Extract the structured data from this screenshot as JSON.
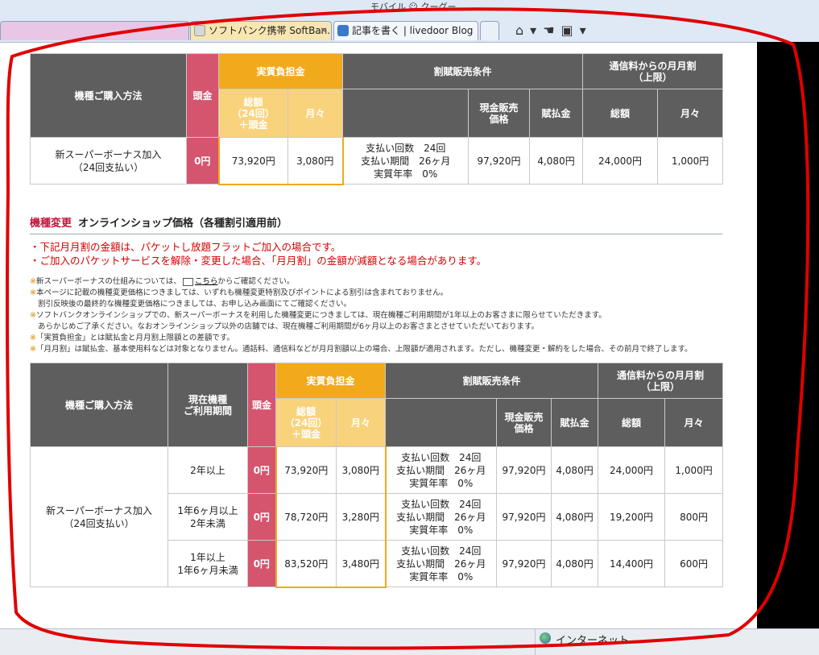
{
  "browser": {
    "top_strip_text": "モバイル ☺ クーグー",
    "tabs": [
      {
        "label": "ソフトバンク携帯 SoftBan...",
        "active": true
      },
      {
        "label": "記事を書く | livedoor Blog",
        "active": false
      }
    ],
    "close_glyph": "✕",
    "toolbar_icons": [
      "home-icon",
      "hand-icon",
      "rss-icon"
    ]
  },
  "table1": {
    "head": {
      "method": "機種ご購入方法",
      "down": "頭金",
      "burden": "実質負担金",
      "total": "総額\n（24回）\n＋頭金",
      "monthly": "月々",
      "installment": "割賦販売条件",
      "cash_price": "現金販売\n価格",
      "paid": "賦払金",
      "discount": "通信料からの月月割\n（上限）",
      "disc_total": "総額",
      "disc_monthly": "月々"
    },
    "row": {
      "method": "新スーパーボーナス加入\n（24回支払い）",
      "down": "0円",
      "total": "73,920円",
      "monthly": "3,080円",
      "terms": "支払い回数　24回\n支払い期間　26ヶ月\n実質年率　0%",
      "cash": "97,920円",
      "paid": "4,080円",
      "disc_total": "24,000円",
      "disc_monthly": "1,000円"
    }
  },
  "section": {
    "tag": "機種変更",
    "title": "オンラインショップ価格（各種割引適用前）",
    "red_notes": [
      "・下記月月割の金額は、パケットし放題フラットご加入の場合です。",
      "・ご加入のパケットサービスを解除・変更した場合、「月月割」の金額が減額となる場合があります。"
    ],
    "notes": {
      "mark": "※",
      "n1_pre": "新スーパーボーナスの仕組みについては、",
      "n1_link": "こちら",
      "n1_post": "からご確認ください。",
      "n2": "本ページに記載の機種変更価格につきましては、いずれも機種変更特割及びポイントによる割引は含まれておりません。",
      "n2b": "割引反映後の最終的な機種変更価格につきましては、お申し込み画面にてご確認ください。",
      "n3": "ソフトバンクオンラインショップでの、新スーパーボーナスを利用した機種変更につきましては、現在機種ご利用期間が1年以上のお客さまに限らせていただきます。",
      "n3b": "あらかじめご了承ください。なおオンラインショップ以外の店舗では、現在機種ご利用期間が6ヶ月以上のお客さまとさせていただいております。",
      "n4": "「実質負担金」とは賦払金と月月割上限額との差額です。",
      "n5": "「月月割」は賦払金、基本使用料などは対象となりません。通話料、通信料などが月月割額以上の場合、上限額が適用されます。ただし、機種変更・解約をした場合、その前月で終了します。"
    }
  },
  "table2": {
    "head": {
      "method": "機種ご購入方法",
      "period": "現在機種\nご利用期間",
      "down": "頭金",
      "burden": "実質負担金",
      "total": "総額\n（24回）\n＋頭金",
      "monthly": "月々",
      "installment": "割賦販売条件",
      "cash_price": "現金販売\n価格",
      "paid": "賦払金",
      "discount": "通信料からの月月割\n（上限）",
      "disc_total": "総額",
      "disc_monthly": "月々"
    },
    "method": "新スーパーボーナス加入\n（24回支払い）",
    "rows": [
      {
        "period": "2年以上",
        "down": "0円",
        "total": "73,920円",
        "monthly": "3,080円",
        "terms": "支払い回数　24回\n支払い期間　26ヶ月\n実質年率　0%",
        "cash": "97,920円",
        "paid": "4,080円",
        "disc_total": "24,000円",
        "disc_monthly": "1,000円"
      },
      {
        "period": "1年6ヶ月以上\n2年未満",
        "down": "0円",
        "total": "78,720円",
        "monthly": "3,280円",
        "terms": "支払い回数　24回\n支払い期間　26ヶ月\n実質年率　0%",
        "cash": "97,920円",
        "paid": "4,080円",
        "disc_total": "19,200円",
        "disc_monthly": "800円"
      },
      {
        "period": "1年以上\n1年6ヶ月未満",
        "down": "0円",
        "total": "83,520円",
        "monthly": "3,480円",
        "terms": "支払い回数　24回\n支払い期間　26ヶ月\n実質年率　0%",
        "cash": "97,920円",
        "paid": "4,080円",
        "disc_total": "14,400円",
        "disc_monthly": "600円"
      }
    ]
  },
  "status_bar": {
    "zone": "インターネット"
  },
  "colors": {
    "header_gray": "#5e5e5e",
    "pink": "#d5546e",
    "orange": "#f2a91c",
    "red_text": "#d60000",
    "annotation_red": "#e00000"
  }
}
